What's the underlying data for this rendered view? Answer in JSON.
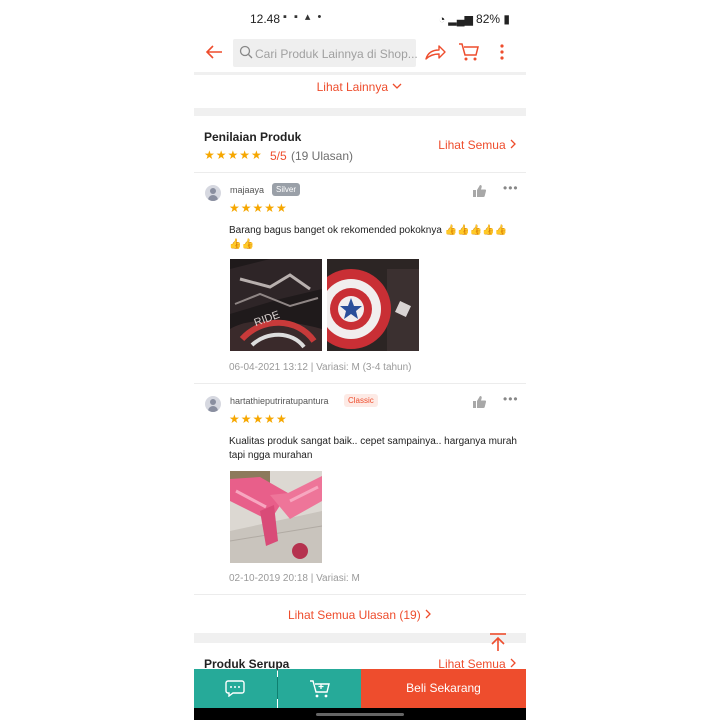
{
  "status_bar": {
    "time": "12.48",
    "battery": "82%"
  },
  "search": {
    "placeholder": "Cari Produk Lainnya di Shop..."
  },
  "see_more": {
    "label": "Lihat Lainnya"
  },
  "rating": {
    "title": "Penilaian Produk",
    "stars": "★★★★★",
    "score": "5/5",
    "count": "(19 Ulasan)",
    "see_all": "Lihat Semua"
  },
  "reviews": [
    {
      "username": "majaaya",
      "badge": "Silver",
      "stars": "★★★★★",
      "text": "Barang bagus banget ok rekomended pokoknya 👍👍👍👍👍👍👍",
      "meta": "06-04-2021 13:12 | Variasi: M (3-4 tahun)"
    },
    {
      "username": "hartathieputriratupantura",
      "badge": "Classic",
      "stars": "★★★★★",
      "text": "Kualitas produk sangat baik.. cepet sampainya.. harganya murah tapi ngga murahan",
      "meta": "02-10-2019 20:18 | Variasi: M"
    }
  ],
  "all_reviews": {
    "label": "Lihat Semua Ulasan (19)"
  },
  "similar": {
    "title": "Produk Serupa",
    "see_all": "Lihat Semua"
  },
  "bottom_bar": {
    "buy_label": "Beli Sekarang"
  },
  "colors": {
    "accent": "#ee4d2d",
    "teal": "#26aa99",
    "star": "#f6a700"
  },
  "icons": [
    "back-arrow-icon",
    "search-icon",
    "share-icon",
    "cart-icon",
    "more-vertical-icon",
    "thumbs-up-icon",
    "more-horizontal-icon",
    "chat-icon",
    "add-to-cart-icon",
    "scroll-to-top-icon"
  ]
}
